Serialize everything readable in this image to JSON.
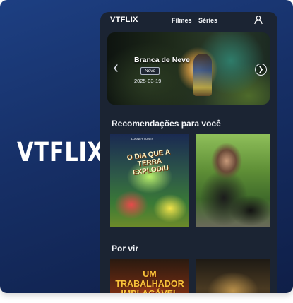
{
  "brand": {
    "name": "VTFLIX"
  },
  "app": {
    "logo": "VTFLIX",
    "nav": {
      "filmes": "Filmes",
      "series": "Séries"
    },
    "user_icon": "user-icon"
  },
  "hero": {
    "title": "Branca de Neve",
    "badge": "Novo",
    "date": "2025-03-19",
    "prev_icon": "chevron-left-icon",
    "next_icon": "chevron-right-icon"
  },
  "sections": {
    "recommendations": "Recomendações para você",
    "upcoming": "Por vir"
  },
  "posters": {
    "p1_title": "O DIA QUE A TERRA EXPLODIU",
    "p1_top": "LOONEY TUNES",
    "p3_title": "UM TRABALHADOR IMPLACÁVEL"
  },
  "colors": {
    "background_gradient_start": "#1d3f82",
    "background_gradient_end": "#0f1f48",
    "app_background": "#1b2433",
    "text": "#ffffff"
  }
}
